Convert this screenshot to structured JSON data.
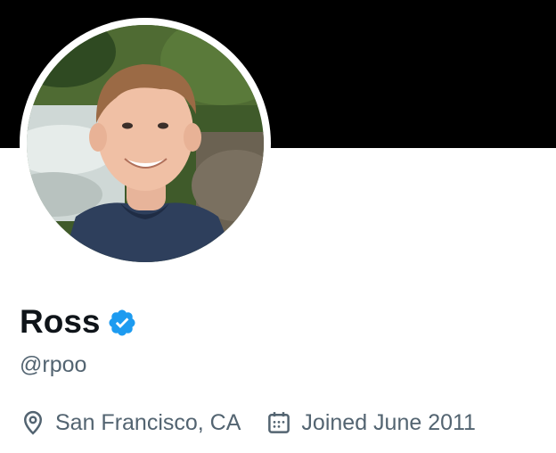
{
  "profile": {
    "display_name": "Ross",
    "handle": "@rpoo",
    "verified": true,
    "location": "San Francisco, CA",
    "joined": "Joined June 2011",
    "icons": {
      "verified": "verified-badge-icon",
      "location": "location-pin-icon",
      "joined": "calendar-icon"
    }
  },
  "colors": {
    "banner": "#000000",
    "name": "#0f1419",
    "secondary_text": "#536471",
    "verified_blue": "#1d9bf0"
  }
}
